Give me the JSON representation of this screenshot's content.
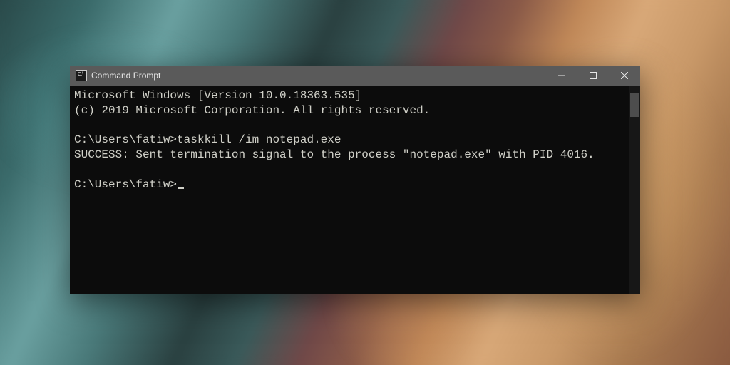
{
  "window": {
    "title": "Command Prompt",
    "icon_label": "C:\\"
  },
  "terminal": {
    "header_line1": "Microsoft Windows [Version 10.0.18363.535]",
    "header_line2": "(c) 2019 Microsoft Corporation. All rights reserved.",
    "prompt1": "C:\\Users\\fatiw>",
    "command1": "taskkill /im notepad.exe",
    "output1": "SUCCESS: Sent termination signal to the process \"notepad.exe\" with PID 4016.",
    "prompt2": "C:\\Users\\fatiw>"
  }
}
